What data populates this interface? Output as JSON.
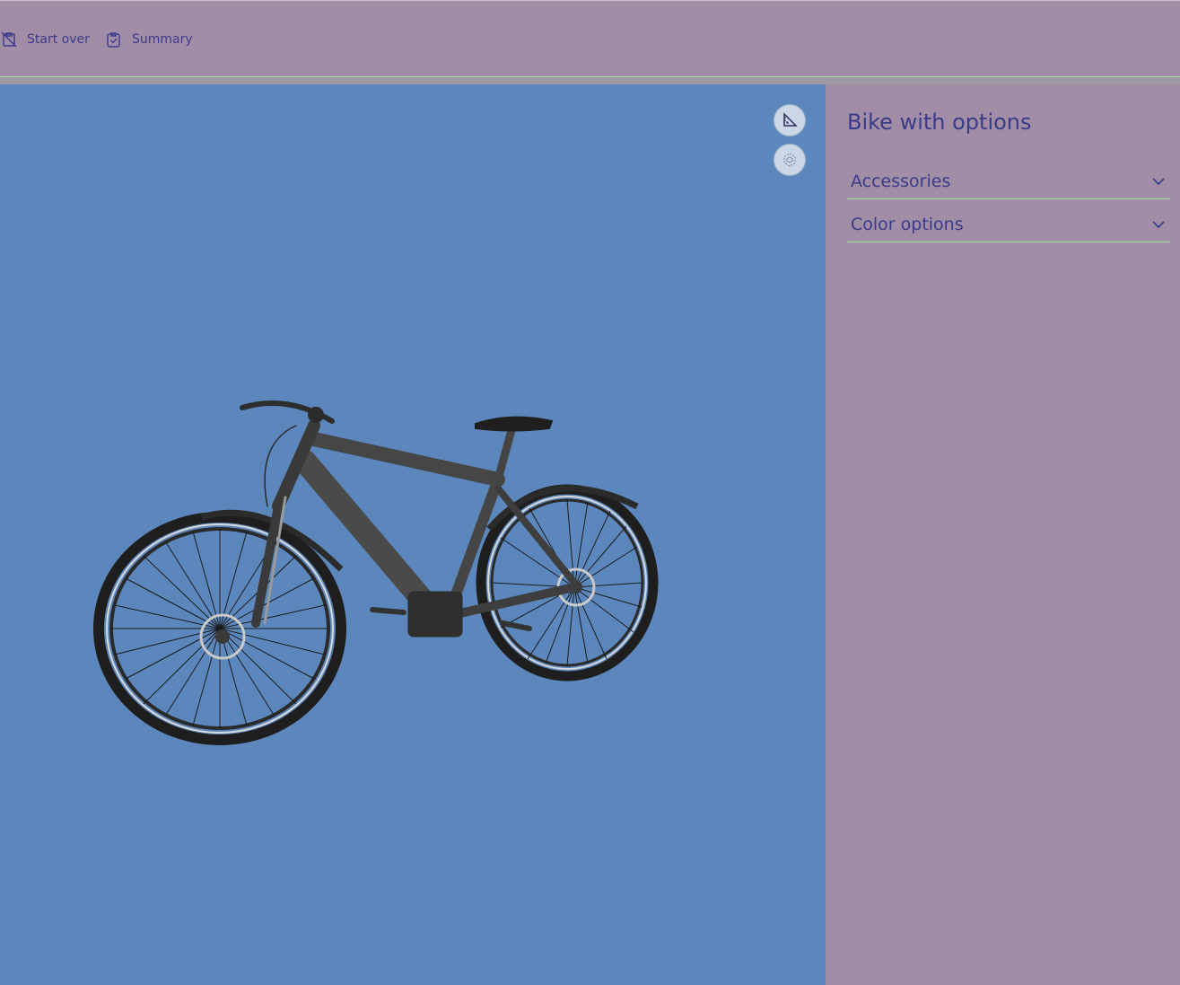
{
  "toolbar": {
    "start_over_label": "Start over",
    "summary_label": "Summary"
  },
  "viewer": {
    "background_color": "#5b87bc",
    "buttons": [
      {
        "name": "measure-icon"
      },
      {
        "name": "fit-view-icon"
      }
    ]
  },
  "panel": {
    "title": "Bike with options",
    "sections": [
      {
        "label": "Accessories",
        "icon": "chevron-down-icon"
      },
      {
        "label": "Color options",
        "icon": "chevron-down-icon"
      }
    ]
  },
  "colors": {
    "accent_text": "#3a3a8a",
    "panel_bg": "#a18ea6",
    "divider": "#9fe0a4"
  }
}
